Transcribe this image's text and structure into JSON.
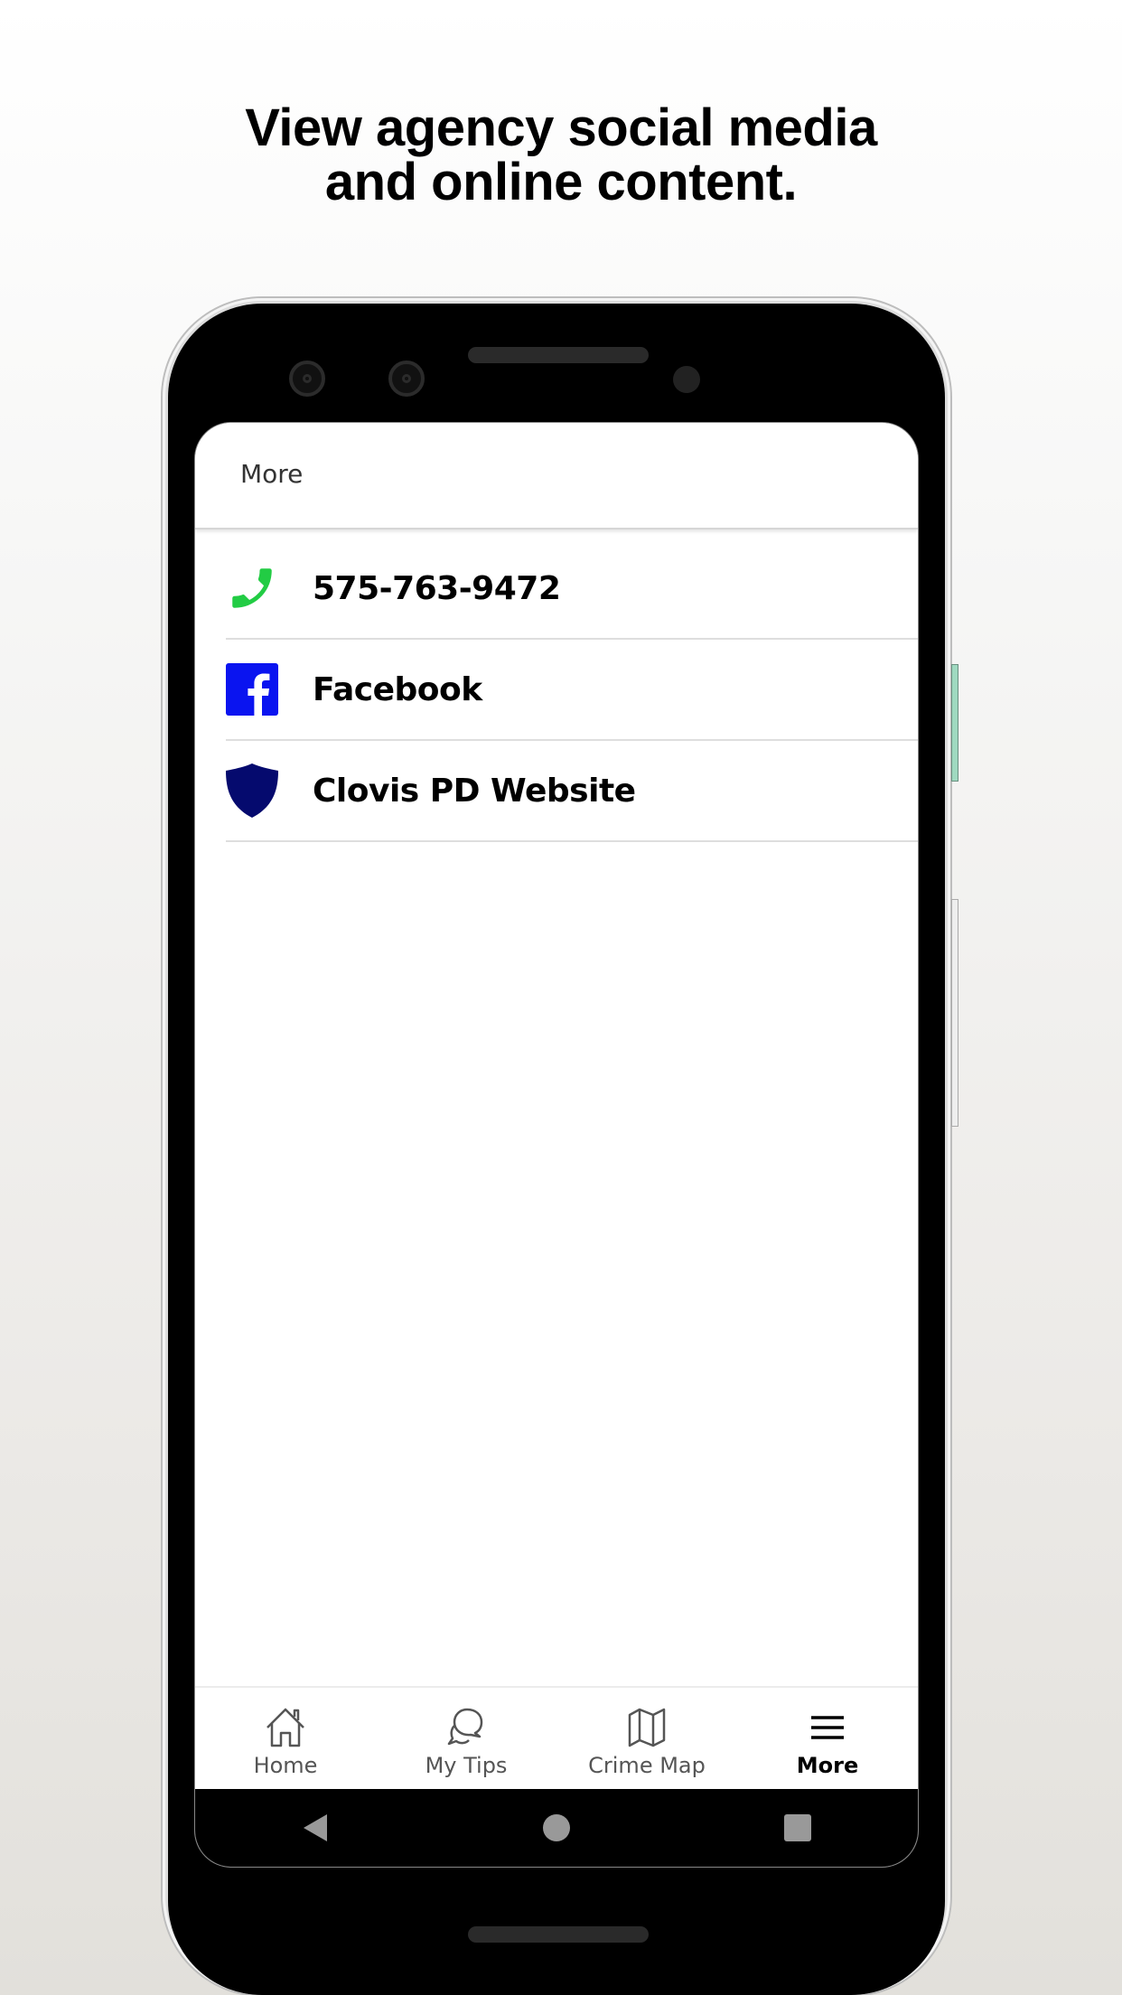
{
  "headline": {
    "line1": "View agency social media",
    "line2": "and online content."
  },
  "app": {
    "title": "More",
    "colors": {
      "phone_icon": "#22cc44",
      "facebook_blue": "#0a14f0",
      "shield_navy": "#050a6e",
      "active_tab": "#000000",
      "inactive_tab": "#555555"
    },
    "list": [
      {
        "icon": "phone-icon",
        "label": "575-763-9472"
      },
      {
        "icon": "facebook-icon",
        "label": "Facebook"
      },
      {
        "icon": "shield-icon",
        "label": "Clovis PD Website"
      }
    ],
    "tabs": [
      {
        "icon": "home-icon",
        "label": "Home",
        "active": false
      },
      {
        "icon": "chat-bubbles-icon",
        "label": "My Tips",
        "active": false
      },
      {
        "icon": "map-icon",
        "label": "Crime Map",
        "active": false
      },
      {
        "icon": "menu-icon",
        "label": "More",
        "active": true
      }
    ],
    "system_nav": [
      "back-icon",
      "home-circle-icon",
      "recents-icon"
    ]
  }
}
